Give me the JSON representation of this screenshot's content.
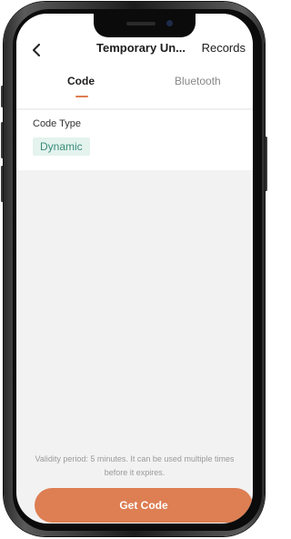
{
  "header": {
    "title": "Temporary Un...",
    "records_label": "Records",
    "back_icon": "chevron-left-icon"
  },
  "tabs": [
    {
      "label": "Code",
      "active": true
    },
    {
      "label": "Bluetooth",
      "active": false
    }
  ],
  "code_type": {
    "label": "Code Type",
    "selected": "Dynamic"
  },
  "footer": {
    "validity_line1": "Validity period: 5 minutes. It can be used multiple times",
    "validity_line2": "before it expires.",
    "button_label": "Get Code"
  },
  "colors": {
    "accent": "#dd7e53",
    "chip_text": "#3a8c78",
    "chip_bg": "#e4f3ee",
    "background": "#f2f2f2"
  }
}
